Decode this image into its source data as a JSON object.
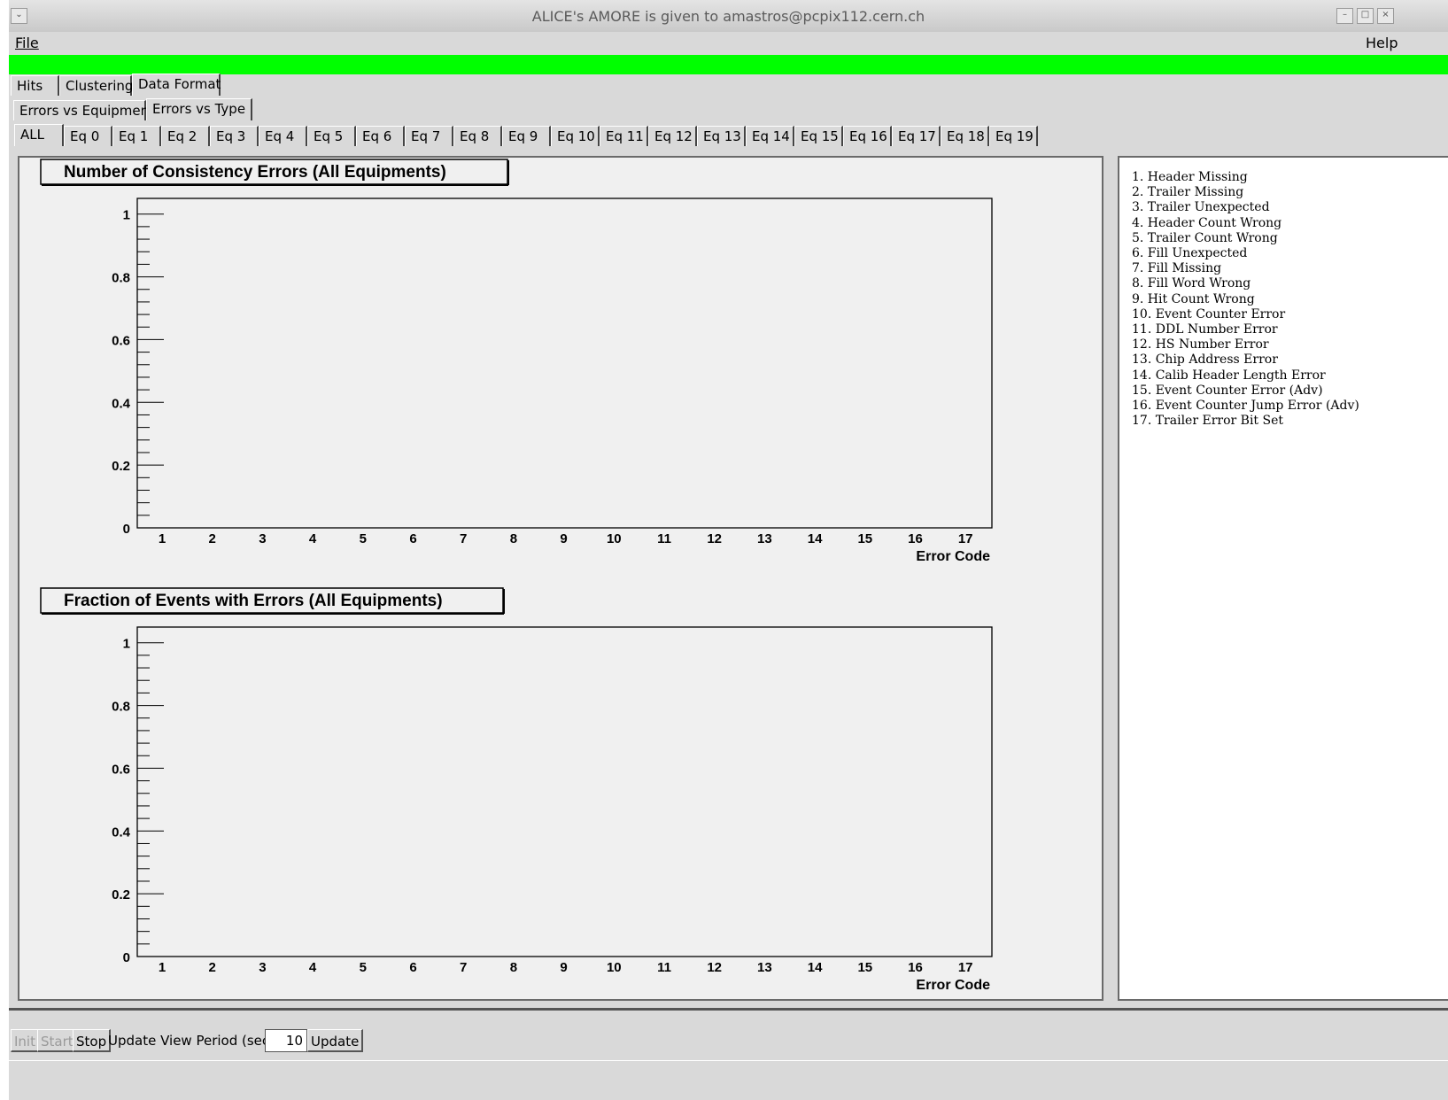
{
  "window": {
    "title": "ALICE's AMORE is given to amastros@pcpix112.cern.ch",
    "controls": [
      "minimize-icon",
      "maximize-icon",
      "close-icon"
    ]
  },
  "menu": {
    "file": "File",
    "help": "Help"
  },
  "tabs_main": [
    {
      "label": "Hits",
      "selected": false
    },
    {
      "label": "Clustering",
      "selected": false
    },
    {
      "label": "Data Format",
      "selected": true
    }
  ],
  "tabs_sub": [
    {
      "label": "Errors vs Equipment",
      "selected": false
    },
    {
      "label": "Errors vs Type",
      "selected": true
    }
  ],
  "tabs_eq": [
    {
      "label": "ALL",
      "selected": true
    },
    {
      "label": "Eq 0"
    },
    {
      "label": "Eq 1"
    },
    {
      "label": "Eq 2"
    },
    {
      "label": "Eq 3"
    },
    {
      "label": "Eq 4"
    },
    {
      "label": "Eq 5"
    },
    {
      "label": "Eq 6"
    },
    {
      "label": "Eq 7"
    },
    {
      "label": "Eq 8"
    },
    {
      "label": "Eq 9"
    },
    {
      "label": "Eq 10"
    },
    {
      "label": "Eq 11"
    },
    {
      "label": "Eq 12"
    },
    {
      "label": "Eq 13"
    },
    {
      "label": "Eq 14"
    },
    {
      "label": "Eq 15"
    },
    {
      "label": "Eq 16"
    },
    {
      "label": "Eq 17"
    },
    {
      "label": "Eq 18"
    },
    {
      "label": "Eq 19"
    }
  ],
  "chart_data": [
    {
      "type": "bar",
      "title": "Number of Consistency Errors (All Equipments)",
      "xlabel": "Error Code",
      "ylabel": "",
      "categories": [
        "1",
        "2",
        "3",
        "4",
        "5",
        "6",
        "7",
        "8",
        "9",
        "10",
        "11",
        "12",
        "13",
        "14",
        "15",
        "16",
        "17"
      ],
      "values": [
        0,
        0,
        0,
        0,
        0,
        0,
        0,
        0,
        0,
        0,
        0,
        0,
        0,
        0,
        0,
        0,
        0
      ],
      "ylim": [
        0,
        1.05
      ],
      "yticks": [
        "0",
        "0.2",
        "0.4",
        "0.6",
        "0.8",
        "1"
      ],
      "grid": false
    },
    {
      "type": "bar",
      "title": "Fraction of Events with Errors (All Equipments)",
      "xlabel": "Error Code",
      "ylabel": "",
      "categories": [
        "1",
        "2",
        "3",
        "4",
        "5",
        "6",
        "7",
        "8",
        "9",
        "10",
        "11",
        "12",
        "13",
        "14",
        "15",
        "16",
        "17"
      ],
      "values": [
        0,
        0,
        0,
        0,
        0,
        0,
        0,
        0,
        0,
        0,
        0,
        0,
        0,
        0,
        0,
        0,
        0
      ],
      "ylim": [
        0,
        1.05
      ],
      "yticks": [
        "0",
        "0.2",
        "0.4",
        "0.6",
        "0.8",
        "1"
      ],
      "grid": false
    }
  ],
  "legend_list": [
    "1.  Header Missing",
    "2.  Trailer Missing",
    "3.  Trailer Unexpected",
    "4.  Header Count Wrong",
    "5.  Trailer Count Wrong",
    "6.  Fill Unexpected",
    "7.  Fill Missing",
    "8.  Fill Word Wrong",
    "9.  Hit Count Wrong",
    "10.  Event Counter Error",
    "11.  DDL Number Error",
    "12.  HS Number Error",
    "13.  Chip Address Error",
    "14.  Calib Header Length Error",
    "15.  Event Counter Error (Adv)",
    "16.  Event Counter Jump Error (Adv)",
    "17.  Trailer Error Bit Set"
  ],
  "status": {
    "init_label": "Init",
    "start_label": "Start",
    "stop_label": "Stop",
    "period_label": "Update View Period (sec)",
    "period_value": "10",
    "update_label": "Update"
  }
}
